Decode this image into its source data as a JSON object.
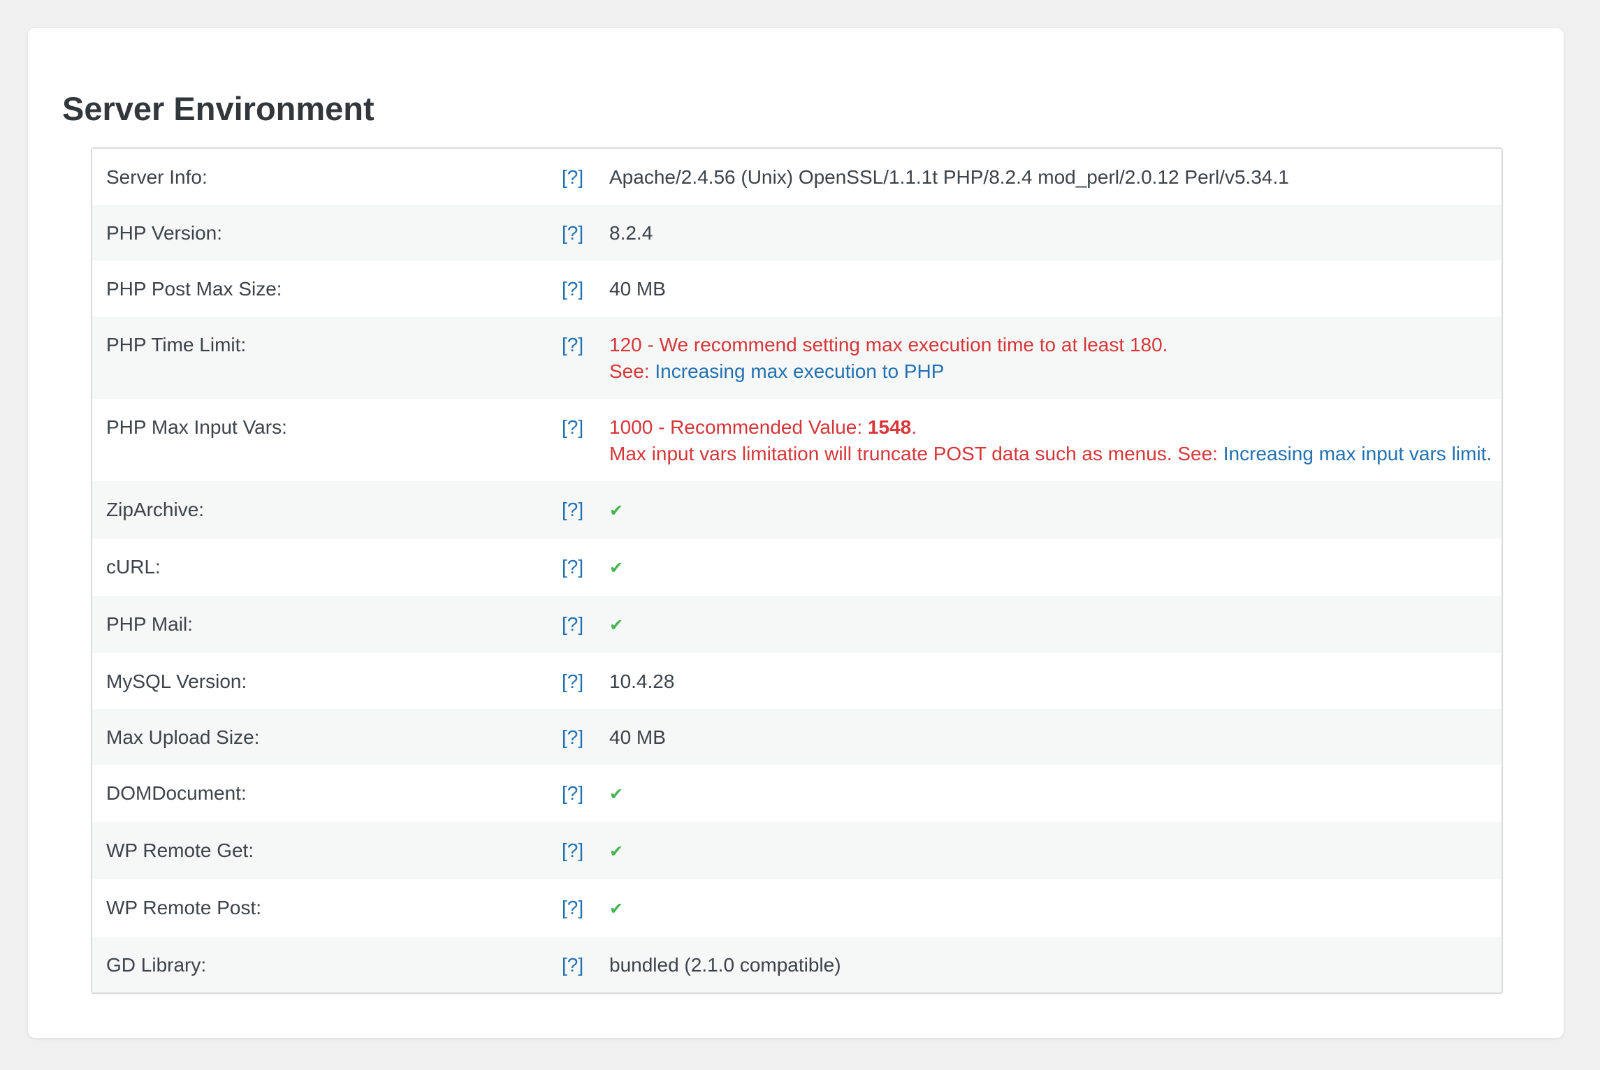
{
  "page": {
    "title": "Server Environment"
  },
  "rows": [
    {
      "label": "Server Info:",
      "help": "[?]",
      "value": "Apache/2.4.56 (Unix) OpenSSL/1.1.1t PHP/8.2.4 mod_perl/2.0.12 Perl/v5.34.1"
    },
    {
      "label": "PHP Version:",
      "help": "[?]",
      "value": "8.2.4"
    },
    {
      "label": "PHP Post Max Size:",
      "help": "[?]",
      "value": "40 MB"
    },
    {
      "label": "PHP Time Limit:",
      "help": "[?]",
      "warning_line1": "120 - We recommend setting max execution time to at least 180.",
      "see_prefix": "See: ",
      "link": "Increasing max execution to PHP"
    },
    {
      "label": "PHP Max Input Vars:",
      "help": "[?]",
      "warning_prefix": "1000 - Recommended Value: ",
      "recommended_value": "1548",
      "warning_suffix": ".",
      "warning_line2": "Max input vars limitation will truncate POST data such as menus. See: ",
      "link": "Increasing max input vars limit."
    },
    {
      "label": "ZipArchive:",
      "help": "[?]",
      "value": "✔"
    },
    {
      "label": "cURL:",
      "help": "[?]",
      "value": "✔"
    },
    {
      "label": "PHP Mail:",
      "help": "[?]",
      "value": "✔"
    },
    {
      "label": "MySQL Version:",
      "help": "[?]",
      "value": "10.4.28"
    },
    {
      "label": "Max Upload Size:",
      "help": "[?]",
      "value": "40 MB"
    },
    {
      "label": "DOMDocument:",
      "help": "[?]",
      "value": "✔"
    },
    {
      "label": "WP Remote Get:",
      "help": "[?]",
      "value": "✔"
    },
    {
      "label": "WP Remote Post:",
      "help": "[?]",
      "value": "✔"
    },
    {
      "label": "GD Library:",
      "help": "[?]",
      "value": "bundled (2.1.0 compatible)"
    }
  ],
  "colors": {
    "warning": "#d63638",
    "link": "#2271b1",
    "check": "#46b450",
    "text": "#3c434a",
    "stripe": "#f6f7f7"
  }
}
